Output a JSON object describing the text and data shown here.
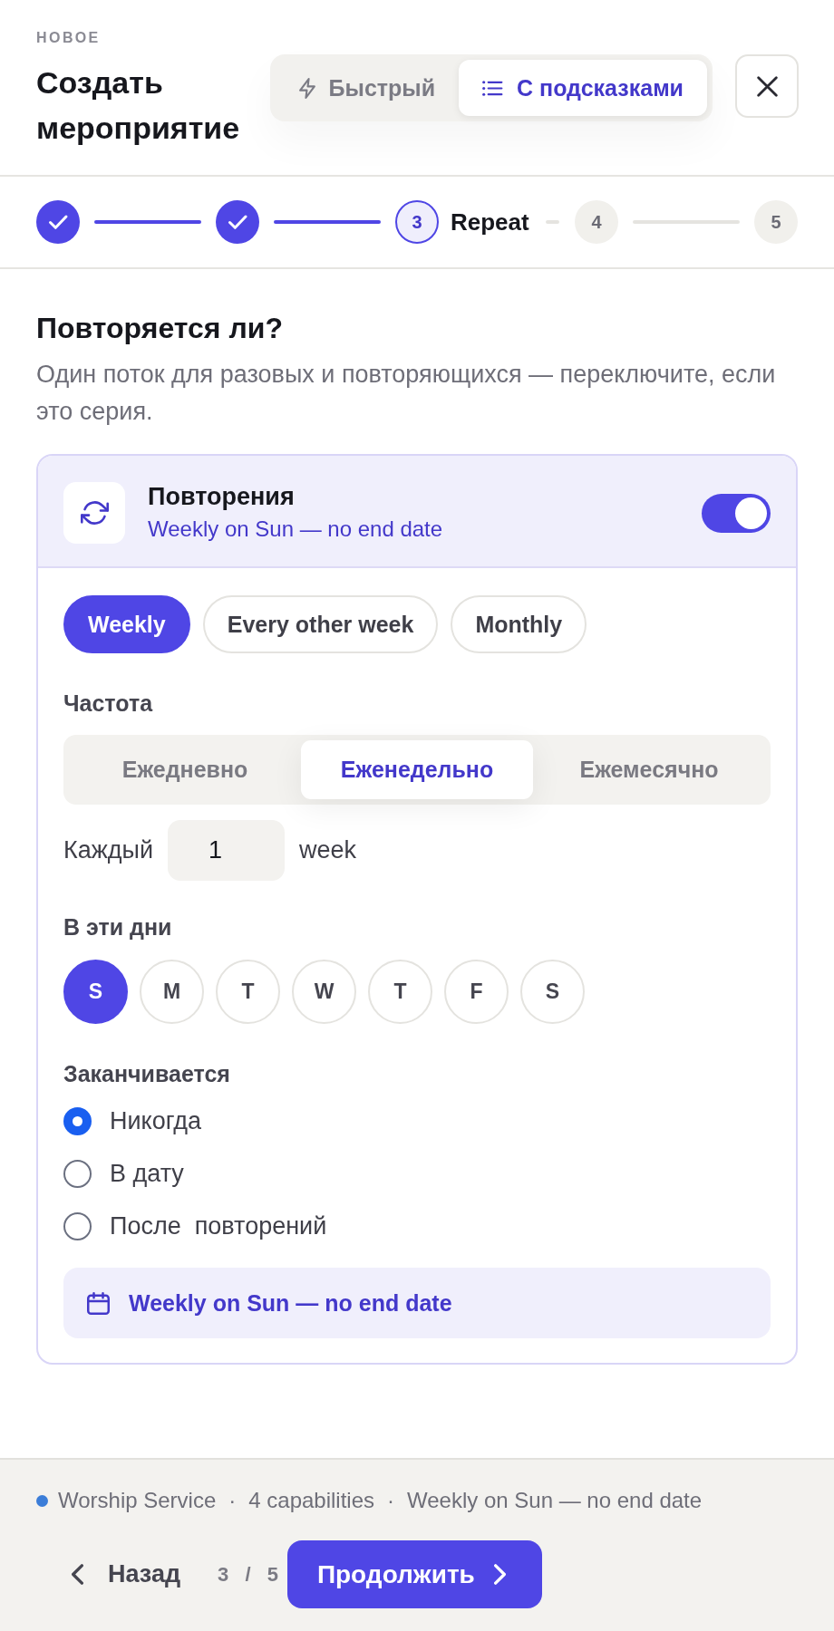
{
  "header": {
    "eyebrow": "НОВОЕ",
    "title": "Создать мероприятие",
    "modes": [
      {
        "kind": "quick",
        "label": "Быстрый",
        "selected": false
      },
      {
        "kind": "guided",
        "label": "С подсказками",
        "selected": true
      }
    ]
  },
  "stepper": {
    "steps": [
      {
        "done": true,
        "selected": false
      },
      {
        "done": true,
        "selected": false
      },
      {
        "done": false,
        "selected": true,
        "number": "3",
        "label": "Repeat"
      },
      {
        "done": false,
        "selected": false,
        "number": "4"
      },
      {
        "done": false,
        "selected": false,
        "number": "5"
      }
    ]
  },
  "section": {
    "title": "Повторяется ли?",
    "description": "Один поток для разовых и повторяющихся — переключите, если это серия."
  },
  "recurrence": {
    "title": "Повторения",
    "summary": "Weekly on Sun — no end date",
    "on": true,
    "presets": [
      {
        "label": "Weekly",
        "selected": true
      },
      {
        "label": "Every other week",
        "selected": false
      },
      {
        "label": "Monthly",
        "selected": false
      }
    ],
    "frequency": {
      "label": "Частота",
      "options": [
        {
          "label": "Ежедневно",
          "selected": false
        },
        {
          "label": "Еженедельно",
          "selected": true
        },
        {
          "label": "Ежемесячно",
          "selected": false
        }
      ]
    },
    "interval": {
      "label": "Каждый",
      "value": "1",
      "unit": "week"
    },
    "days": {
      "label": "В эти дни",
      "items": [
        {
          "label": "S",
          "selected": true
        },
        {
          "label": "M",
          "selected": false
        },
        {
          "label": "T",
          "selected": false
        },
        {
          "label": "W",
          "selected": false
        },
        {
          "label": "T",
          "selected": false
        },
        {
          "label": "F",
          "selected": false
        },
        {
          "label": "S",
          "selected": false
        }
      ]
    },
    "ends": {
      "label": "Заканчивается",
      "options": [
        {
          "label": "Никогда",
          "selected": true
        },
        {
          "label": "В дату",
          "selected": false
        },
        {
          "label": "После  повторений",
          "selected": false
        }
      ]
    },
    "note": "Weekly on Sun — no end date"
  },
  "footer": {
    "meta": [
      {
        "kind": "tag",
        "text": "Worship Service",
        "color": "#3b7dd8"
      },
      {
        "kind": "separator",
        "text": "·"
      },
      {
        "kind": "text",
        "text": "4 capabilities"
      },
      {
        "kind": "separator",
        "text": "·"
      },
      {
        "kind": "text",
        "text": "Weekly on Sun — no end date"
      }
    ],
    "back": "Назад",
    "progress": "3 / 5",
    "next": "Продолжить"
  }
}
